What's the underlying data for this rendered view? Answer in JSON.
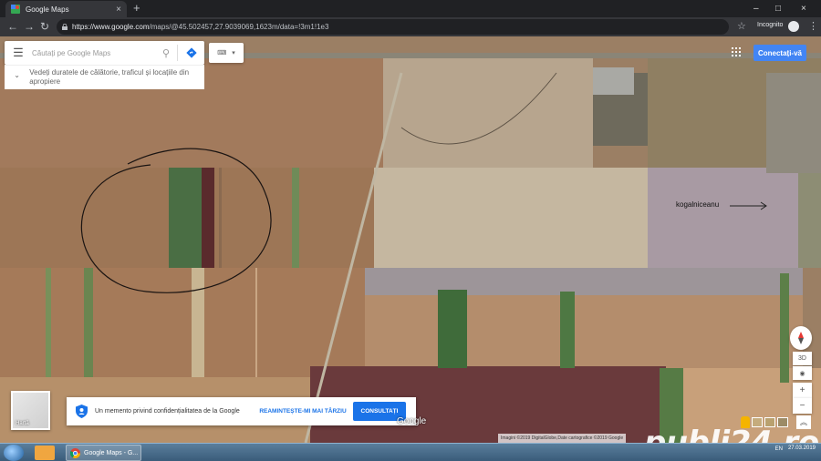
{
  "browser": {
    "tab_title": "Google Maps",
    "tab_close": "×",
    "new_tab": "+",
    "url_host": "https://www.google.com",
    "url_path": "/maps/@45.502457,27.9039069,1623m/data=!3m1!1e3",
    "incognito_label": "Incognito",
    "window_controls": [
      "–",
      "□",
      "×"
    ]
  },
  "maps": {
    "search_placeholder": "Căutați pe Google Maps",
    "hint_text": "Vedeți duratele de călătorie, traficul și locațiile din apropiere",
    "sign_in_label": "Conectați-vă",
    "map_label": "kogalniceanu",
    "minimap_label": "Hartă",
    "privacy_message": "Un memento privind confidențialitatea de la Google",
    "remind_later": "REAMINTEȘTE-MI MAI TÂRZIU",
    "consult": "CONSULTAȚI",
    "google_logo": "Google",
    "attribution": "Imagini ©2019 DigitalGlobe,Date cartografice ©2019 Google",
    "control_3d": "3D",
    "zoom_in": "+",
    "zoom_out": "−",
    "expand_icon": "chevron-up-icon"
  },
  "watermark": {
    "text_main": "publi24",
    "text_tld": ".ro"
  },
  "taskbar": {
    "chrome_label": "Google Maps - G...",
    "lang": "EN",
    "time": "",
    "date": "27.03.2019"
  },
  "colors": {
    "accent": "#4285f4",
    "consult_bg": "#1a73e8"
  }
}
